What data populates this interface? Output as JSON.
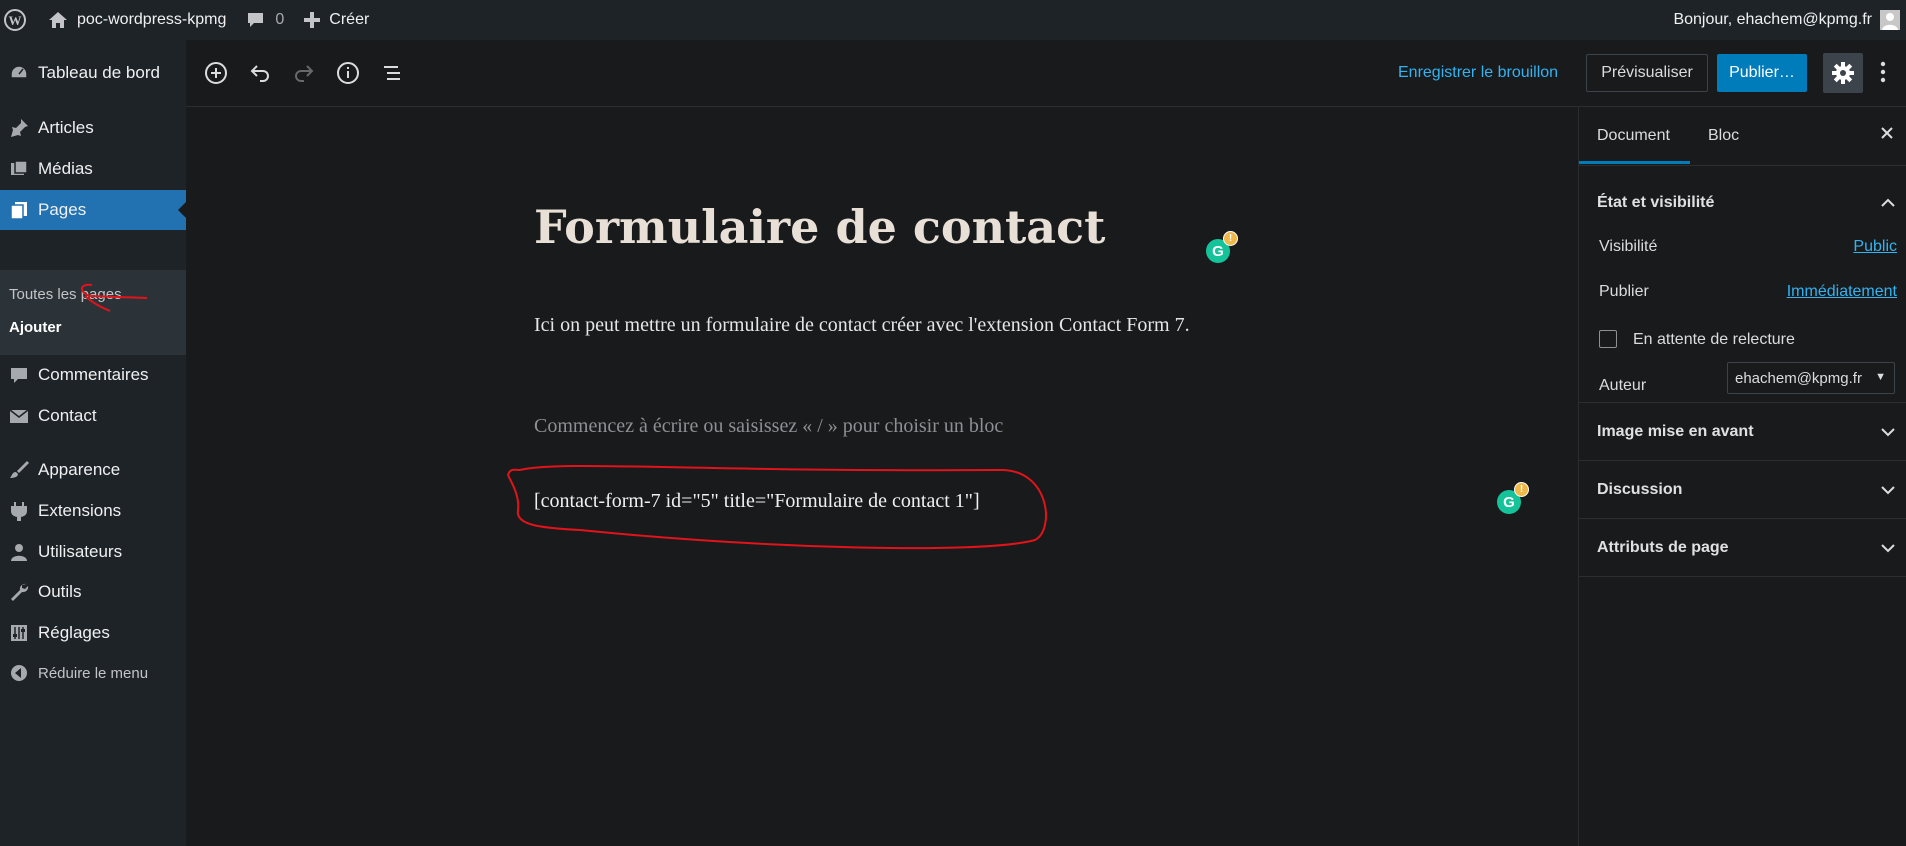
{
  "adminbar": {
    "site_name": "poc-wordpress-kpmg",
    "comments_count": "0",
    "new_label": "Créer",
    "greeting": "Bonjour, ehachem@kpmg.fr"
  },
  "sidebar": {
    "items": [
      {
        "label": "Tableau de bord",
        "icon": "dashboard-icon"
      },
      {
        "label": "Articles",
        "icon": "pin-icon"
      },
      {
        "label": "Médias",
        "icon": "media-icon"
      },
      {
        "label": "Pages",
        "icon": "pages-icon"
      },
      {
        "label": "Commentaires",
        "icon": "comment-icon"
      },
      {
        "label": "Contact",
        "icon": "mail-icon"
      },
      {
        "label": "Apparence",
        "icon": "brush-icon"
      },
      {
        "label": "Extensions",
        "icon": "plugin-icon"
      },
      {
        "label": "Utilisateurs",
        "icon": "user-icon"
      },
      {
        "label": "Outils",
        "icon": "wrench-icon"
      },
      {
        "label": "Réglages",
        "icon": "settings-sliders-icon"
      },
      {
        "label": "Réduire le menu",
        "icon": "collapse-icon"
      }
    ],
    "submenu": [
      "Toutes les pages",
      "Ajouter"
    ]
  },
  "toolbar": {
    "save_draft": "Enregistrer le brouillon",
    "preview": "Prévisualiser",
    "publish": "Publier…"
  },
  "editor": {
    "title": "Formulaire de contact",
    "paragraph": "Ici on peut mettre un formulaire de contact créer avec l'extension Contact Form 7.",
    "placeholder": "Commencez à écrire ou saisissez « / » pour choisir un bloc",
    "shortcode": "[contact-form-7 id=\"5\" title=\"Formulaire de contact 1\"]"
  },
  "settings": {
    "tabs": [
      "Document",
      "Bloc"
    ],
    "status_section": {
      "title": "État et visibilité",
      "visibility_label": "Visibilité",
      "visibility_value": "Public",
      "publish_label": "Publier",
      "publish_value": "Immédiatement",
      "pending_review": "En attente de relecture",
      "author_label": "Auteur",
      "author_value": "ehachem@kpmg.fr"
    },
    "sections": [
      "Image mise en avant",
      "Discussion",
      "Attributs de page"
    ]
  },
  "colors": {
    "accent": "#007cba",
    "link": "#33b3f0",
    "annotation": "#e0141a",
    "grammarly": "#15c39a"
  }
}
